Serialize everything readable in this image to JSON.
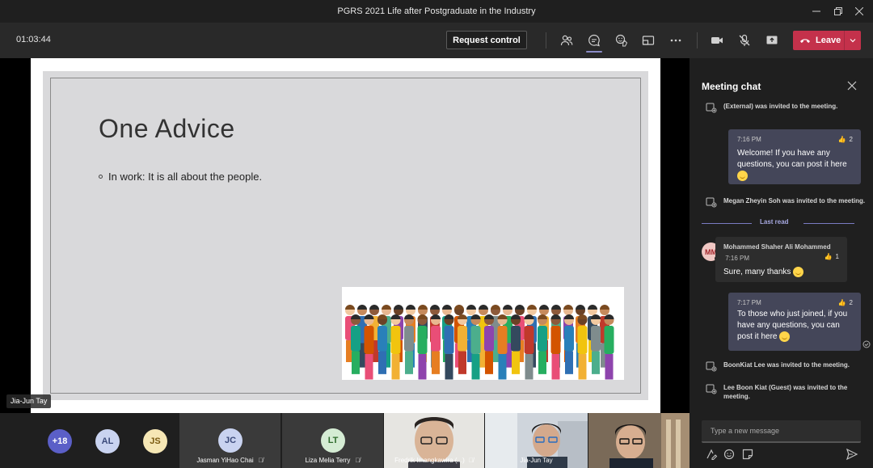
{
  "window": {
    "title": "PGRS 2021 Life after Postgraduate in the Industry"
  },
  "toolbar": {
    "timer": "01:03:44",
    "request_control_label": "Request control",
    "leave_label": "Leave"
  },
  "slide": {
    "title": "One Advice",
    "bullet": "In work: It is all about the people."
  },
  "presenter": {
    "name": "Jia-Jun Tay"
  },
  "chat": {
    "title": "Meeting chat",
    "events": [
      {
        "text": "(External) was invited to the meeting."
      },
      {
        "text": "Megan Zheyin Soh was invited to the meeting."
      },
      {
        "text": "BoonKiat Lee was invited to the meeting."
      },
      {
        "text": "Lee Boon Kiat (Guest) was invited to the meeting."
      }
    ],
    "messages": [
      {
        "time": "7:16 PM",
        "text": "Welcome! If you have any questions, you can post it here",
        "reactions": "2"
      },
      {
        "sender": "Mohammed Shaher Ali Mohammed",
        "initials": "MM",
        "time": "7:16 PM",
        "text": "Sure, many thanks",
        "reactions": "1"
      },
      {
        "time": "7:17 PM",
        "text": "To those who just joined, if you have any questions, you can post it here",
        "reactions": "2"
      }
    ],
    "last_read_label": "Last read",
    "compose_placeholder": "Type a new message"
  },
  "participants": {
    "overflow_count": "+18",
    "avatars": [
      {
        "initials": "AL",
        "bg": "#c9d3f0",
        "fg": "#3b4a7a"
      },
      {
        "initials": "JS",
        "bg": "#f6e7b5",
        "fg": "#7a5a10"
      }
    ],
    "tiles": [
      {
        "initials": "JC",
        "name": "Jasman YiHao Chai",
        "bg": "#c9d3f0",
        "fg": "#3b4a7a"
      },
      {
        "initials": "LT",
        "name": "Liza Melia Terry",
        "bg": "#d5ecd4",
        "fg": "#2e6b2c"
      }
    ],
    "videos": [
      {
        "name": "Fredrik Imangkawira (...)"
      },
      {
        "name": "Jia-Jun Tay"
      },
      {
        "name": ""
      }
    ]
  },
  "colors": {
    "leave": "#c4314b",
    "accent": "#8b8cc7",
    "my_bubble": "#444659"
  }
}
